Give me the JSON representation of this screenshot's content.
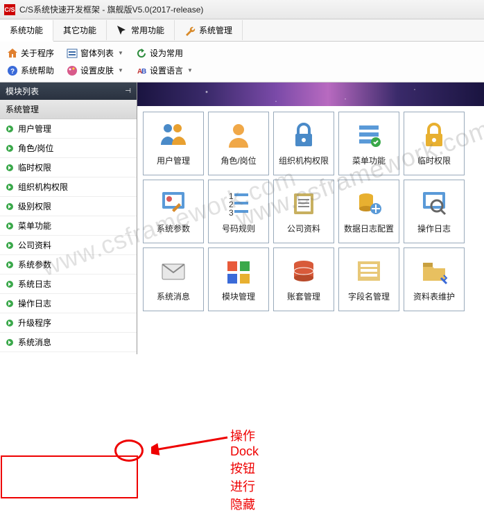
{
  "titlebar": {
    "icon_text": "C/S",
    "title": "C/S系统快速开发框架 - 旗舰版V5.0(2017-release)"
  },
  "tabs": [
    {
      "label": "系统功能",
      "active": true
    },
    {
      "label": "其它功能",
      "active": false
    },
    {
      "label": "常用功能",
      "active": false
    },
    {
      "label": "系统管理",
      "active": false
    }
  ],
  "toolbar_row1": [
    {
      "id": "about",
      "label": "关于程序",
      "icon": "home"
    },
    {
      "id": "winlist",
      "label": "窗体列表",
      "icon": "list",
      "dropdown": true
    },
    {
      "id": "setcommon",
      "label": "设为常用",
      "icon": "star"
    }
  ],
  "toolbar_row2": [
    {
      "id": "help",
      "label": "系统帮助",
      "icon": "help"
    },
    {
      "id": "skin",
      "label": "设置皮肤",
      "icon": "palette",
      "dropdown": true
    },
    {
      "id": "lang",
      "label": "设置语言",
      "icon": "lang",
      "dropdown": true
    }
  ],
  "sidebar": {
    "panel_title": "模块列表",
    "root_label": "系统管理",
    "items": [
      "用户管理",
      "角色/岗位",
      "临时权限",
      "组织机构权限",
      "级别权限",
      "菜单功能",
      "公司资料",
      "系统参数",
      "系统日志",
      "操作日志",
      "升级程序",
      "系统消息"
    ]
  },
  "grid": [
    {
      "id": "user-mgmt",
      "label": "用户管理",
      "icon": "users"
    },
    {
      "id": "role",
      "label": "角色/岗位",
      "icon": "person"
    },
    {
      "id": "org-perm",
      "label": "组织机构权限",
      "icon": "lock"
    },
    {
      "id": "menu-func",
      "label": "菜单功能",
      "icon": "menu"
    },
    {
      "id": "temp-perm",
      "label": "临时权限",
      "icon": "lock-gold"
    },
    {
      "id": "sys-param",
      "label": "系统参数",
      "icon": "tools"
    },
    {
      "id": "code-rule",
      "label": "号码规则",
      "icon": "numbers"
    },
    {
      "id": "company",
      "label": "公司资料",
      "icon": "company"
    },
    {
      "id": "dblog",
      "label": "数据日志配置",
      "icon": "dbconfig"
    },
    {
      "id": "op-log",
      "label": "操作日志",
      "icon": "search"
    },
    {
      "id": "sys-msg",
      "label": "系统消息",
      "icon": "mail"
    },
    {
      "id": "mod-mgmt",
      "label": "模块管理",
      "icon": "modules"
    },
    {
      "id": "acct-mgmt",
      "label": "账套管理",
      "icon": "db"
    },
    {
      "id": "field-mgmt",
      "label": "字段名管理",
      "icon": "fields"
    },
    {
      "id": "table-maint",
      "label": "资料表维护",
      "icon": "folder"
    }
  ],
  "annotation": {
    "text": "操作Dock按钮进行隐藏"
  },
  "watermark": "www.csframework.com"
}
